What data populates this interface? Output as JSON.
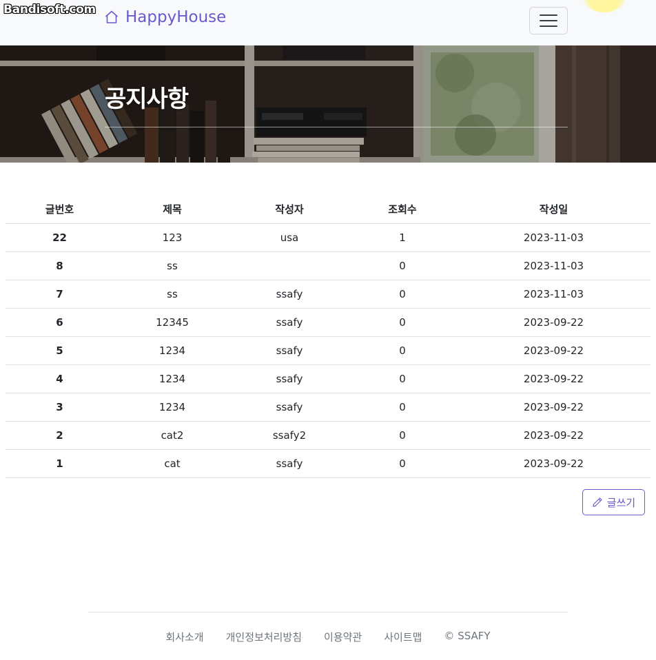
{
  "watermark": "Bandisoft.com",
  "navbar": {
    "brand_text": "HappyHouse",
    "brand_icon": "house-icon",
    "toggler_icon": "hamburger-menu-icon"
  },
  "hero": {
    "title": "공지사항"
  },
  "board": {
    "headers": [
      "글번호",
      "제목",
      "작성자",
      "조회수",
      "작성일"
    ],
    "rows": [
      {
        "no": "22",
        "title": "123",
        "author": "usa",
        "views": "1",
        "date": "2023-11-03"
      },
      {
        "no": "8",
        "title": "ss",
        "author": "",
        "views": "0",
        "date": "2023-11-03"
      },
      {
        "no": "7",
        "title": "ss",
        "author": "ssafy",
        "views": "0",
        "date": "2023-11-03"
      },
      {
        "no": "6",
        "title": "12345",
        "author": "ssafy",
        "views": "0",
        "date": "2023-09-22"
      },
      {
        "no": "5",
        "title": "1234",
        "author": "ssafy",
        "views": "0",
        "date": "2023-09-22"
      },
      {
        "no": "4",
        "title": "1234",
        "author": "ssafy",
        "views": "0",
        "date": "2023-09-22"
      },
      {
        "no": "3",
        "title": "1234",
        "author": "ssafy",
        "views": "0",
        "date": "2023-09-22"
      },
      {
        "no": "2",
        "title": "cat2",
        "author": "ssafy2",
        "views": "0",
        "date": "2023-09-22"
      },
      {
        "no": "1",
        "title": "cat",
        "author": "ssafy",
        "views": "0",
        "date": "2023-09-22"
      }
    ],
    "write_label": "글쓰기",
    "write_icon": "pencil-icon"
  },
  "footer": {
    "links": [
      "회사소개",
      "개인정보처리방침",
      "이용약관",
      "사이트맵"
    ],
    "copyright": "© SSAFY"
  },
  "colors": {
    "accent": "#6a5acd",
    "navbar_bg": "#f8f9fa",
    "footer_text": "#6c757d"
  }
}
